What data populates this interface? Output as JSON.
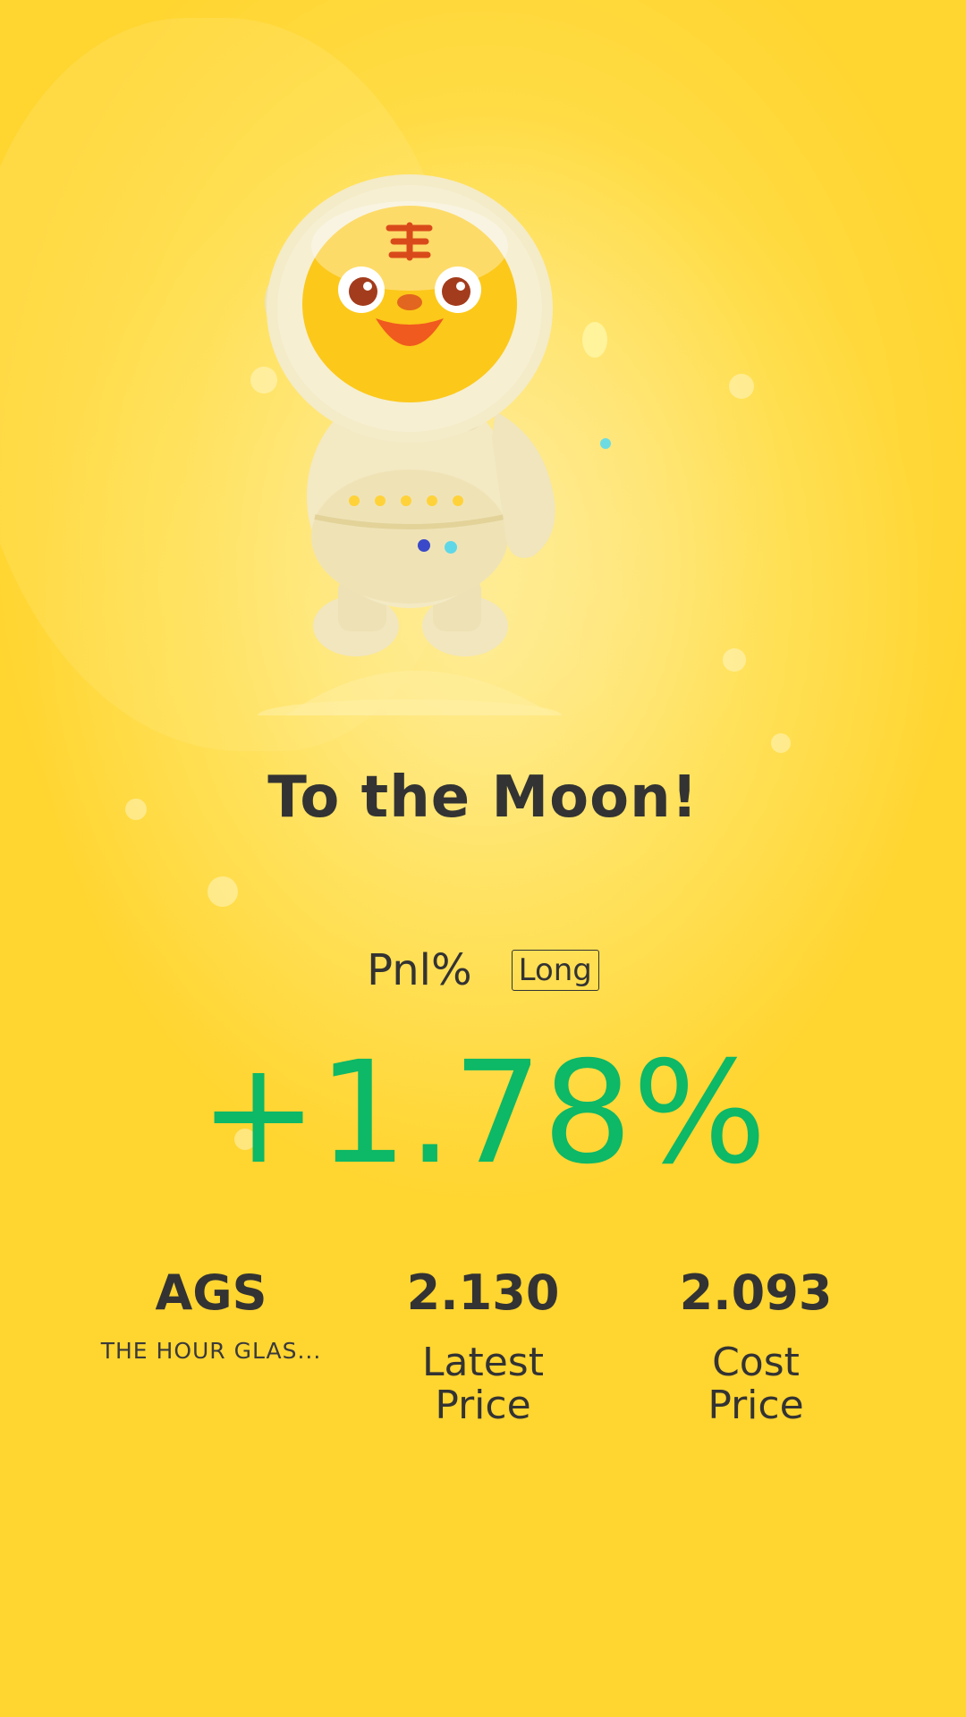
{
  "title": "To the Moon!",
  "pnl": {
    "label": "Pnl%",
    "direction_badge": "Long",
    "value": "+1.78%",
    "value_color": "#0db866"
  },
  "stats": {
    "symbol": "AGS",
    "company_name": "THE HOUR GLAS...",
    "latest_price": "2.130",
    "latest_price_label": "Latest Price",
    "cost_price": "2.093",
    "cost_price_label": "Cost Price"
  },
  "theme": {
    "background": "#ffd936",
    "text": "#333333",
    "positive": "#0db866"
  },
  "illustration": "tiger-astronaut-mascot"
}
